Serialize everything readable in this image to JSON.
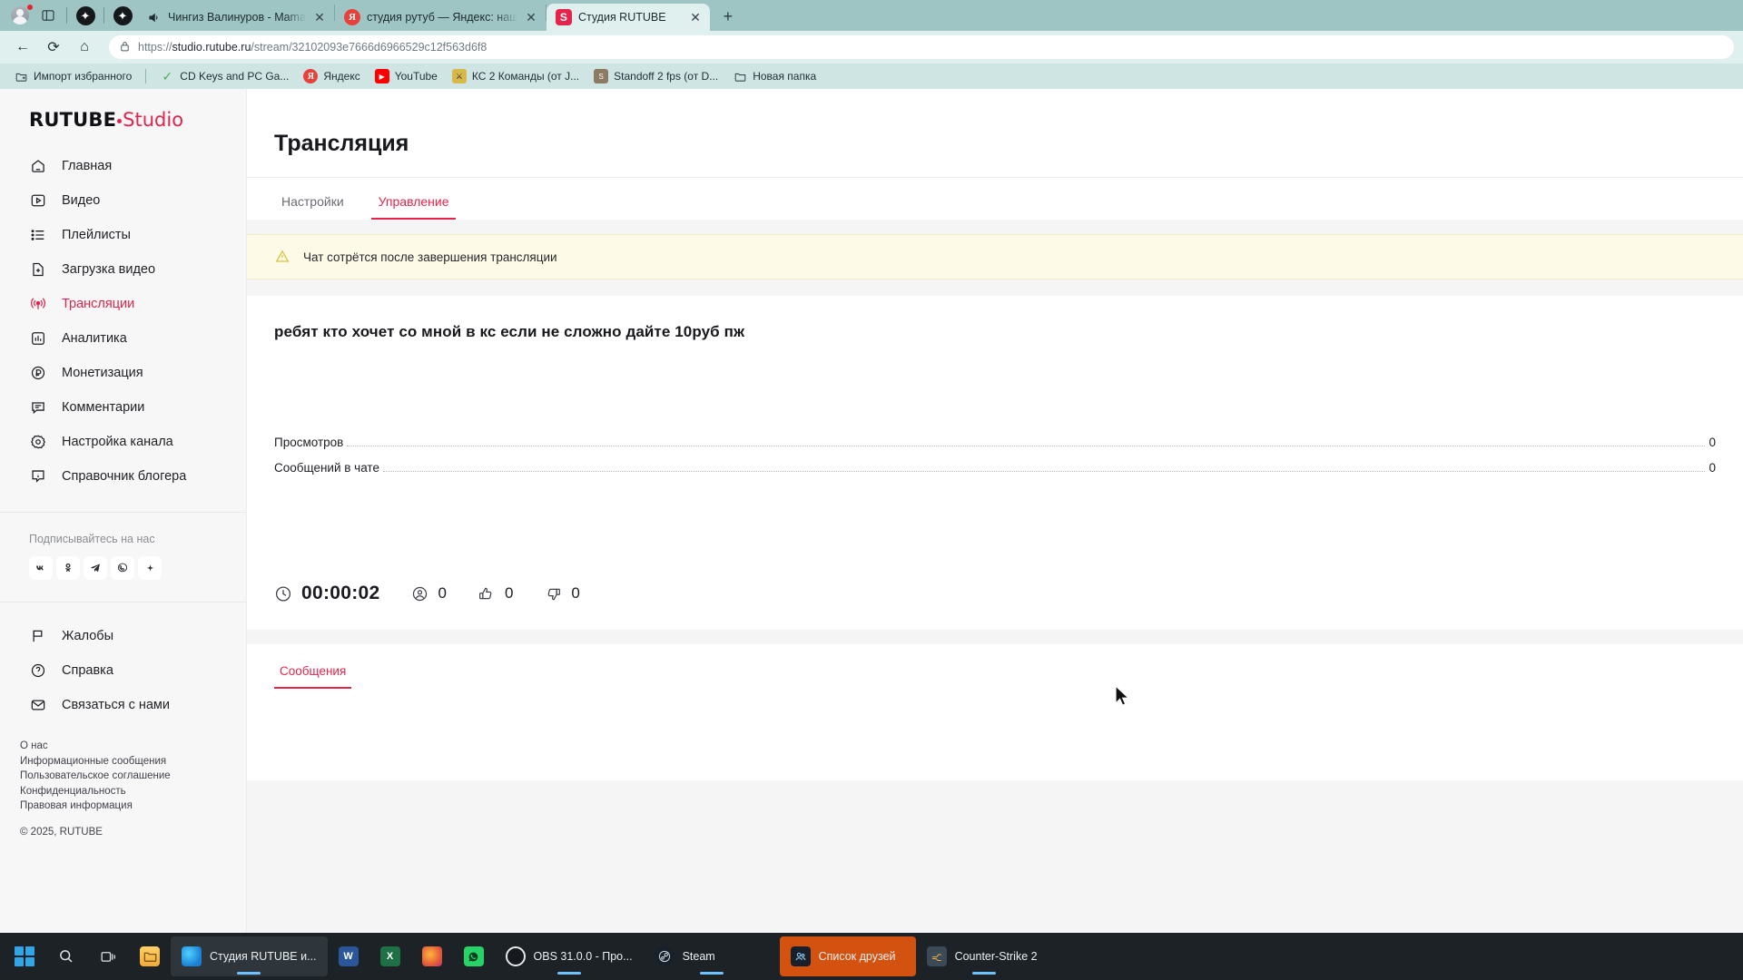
{
  "browser": {
    "tabs": [
      {
        "title": "Чингиз Валинуров - Mama",
        "favicon": "speaker-icon",
        "active": false
      },
      {
        "title": "студия рутуб — Яндекс: нашлос",
        "favicon": "yandex-icon",
        "active": false
      },
      {
        "title": "Студия RUTUBE",
        "favicon": "rutube-icon",
        "active": true
      }
    ],
    "newtab_label": "+",
    "nav": {
      "back": "←",
      "reload": "⟳",
      "home": "⌂"
    },
    "url": {
      "scheme": "https://",
      "host": "studio.rutube.ru",
      "path": "/stream/32102093e7666d6966529c12f563d6f8",
      "full": "https://studio.rutube.ru/stream/32102093e7666d6966529c12f563d6f8"
    },
    "bookmarks": [
      {
        "label": "Импорт избранного",
        "icon": "folder-import-icon"
      },
      {
        "label": "CD Keys and PC Ga...",
        "icon": "cdkeys-icon"
      },
      {
        "label": "Яндекс",
        "icon": "yandex-icon"
      },
      {
        "label": "YouTube",
        "icon": "youtube-icon"
      },
      {
        "label": "КС 2 Команды (от J...",
        "icon": "cs2-icon"
      },
      {
        "label": "Standoff 2 fps (от D...",
        "icon": "standoff-icon"
      },
      {
        "label": "Новая папка",
        "icon": "folder-icon"
      }
    ]
  },
  "sidebar": {
    "logo": {
      "main": "RUTUBE",
      "studio": "Studio"
    },
    "items": [
      {
        "label": "Главная",
        "icon": "home-icon",
        "active": false
      },
      {
        "label": "Видео",
        "icon": "video-icon",
        "active": false
      },
      {
        "label": "Плейлисты",
        "icon": "playlist-icon",
        "active": false
      },
      {
        "label": "Загрузка видео",
        "icon": "upload-icon",
        "active": false
      },
      {
        "label": "Трансляции",
        "icon": "broadcast-icon",
        "active": true
      },
      {
        "label": "Аналитика",
        "icon": "analytics-icon",
        "active": false
      },
      {
        "label": "Монетизация",
        "icon": "ruble-icon",
        "active": false
      },
      {
        "label": "Комментарии",
        "icon": "comments-icon",
        "active": false
      },
      {
        "label": "Настройка канала",
        "icon": "gear-icon",
        "active": false
      },
      {
        "label": "Справочник блогера",
        "icon": "info-icon",
        "active": false
      }
    ],
    "subscribe_title": "Подписывайтесь на нас",
    "socials": [
      {
        "name": "vk-icon",
        "glyph": "B"
      },
      {
        "name": "ok-icon",
        "glyph": "ok"
      },
      {
        "name": "telegram-icon",
        "glyph": "➤"
      },
      {
        "name": "viber-icon",
        "glyph": "✆"
      },
      {
        "name": "more-icon",
        "glyph": "✦"
      }
    ],
    "help_items": [
      {
        "label": "Жалобы",
        "icon": "flag-icon"
      },
      {
        "label": "Справка",
        "icon": "question-icon"
      },
      {
        "label": "Связаться с нами",
        "icon": "mail-icon"
      }
    ],
    "footer_links": [
      "О нас",
      "Информационные сообщения",
      "Пользовательское соглашение",
      "Конфиденциальность",
      "Правовая информация"
    ],
    "copyright": "© 2025, RUTUBE"
  },
  "main": {
    "page_title": "Трансляция",
    "tabs": [
      {
        "label": "Настройки",
        "active": false
      },
      {
        "label": "Управление",
        "active": true
      }
    ],
    "alert": {
      "text": "Чат сотрётся после завершения трансляции",
      "icon": "warning-icon"
    },
    "stream_title": "ребят кто хочет со мной в кс если не сложно дайте 10руб пж",
    "stats": [
      {
        "label": "Просмотров",
        "value": "0"
      },
      {
        "label": "Сообщений в чате",
        "value": "0"
      }
    ],
    "meta": {
      "duration": "00:00:02",
      "viewers": "0",
      "likes": "0",
      "dislikes": "0",
      "duration_icon": "clock-icon",
      "viewers_icon": "viewer-icon",
      "likes_icon": "thumbs-up-icon",
      "dislikes_icon": "thumbs-down-icon"
    },
    "messages_tab": "Сообщения"
  },
  "taskbar": {
    "start": "start-button",
    "search": "search-icon",
    "taskview": "task-view-icon",
    "apps": [
      {
        "label": "",
        "icon": "file-explorer-icon",
        "state": "pinned"
      },
      {
        "label": "Студия RUTUBE и...",
        "icon": "edge-icon",
        "state": "active"
      },
      {
        "label": "",
        "icon": "word-icon",
        "state": "running"
      },
      {
        "label": "",
        "icon": "excel-icon",
        "state": "running"
      },
      {
        "label": "",
        "icon": "firefox-icon",
        "state": "running"
      },
      {
        "label": "",
        "icon": "whatsapp-icon",
        "state": "running"
      },
      {
        "label": "OBS 31.0.0 - Про...",
        "icon": "obs-icon",
        "state": "running"
      },
      {
        "label": "Steam",
        "icon": "steam-icon",
        "state": "running"
      },
      {
        "label": "Список друзей",
        "icon": "friends-list-icon",
        "state": "highlight"
      },
      {
        "label": "Counter-Strike 2",
        "icon": "cs2-icon",
        "state": "running"
      }
    ]
  },
  "colors": {
    "accent": "#e5234b",
    "chrome": "#9ec5c3",
    "navbar": "#dff0ef",
    "bookmarks": "#cfe5e4",
    "alert_bg": "#fdfbe8",
    "taskbar": "#1d2226",
    "highlight": "#d4520f"
  }
}
